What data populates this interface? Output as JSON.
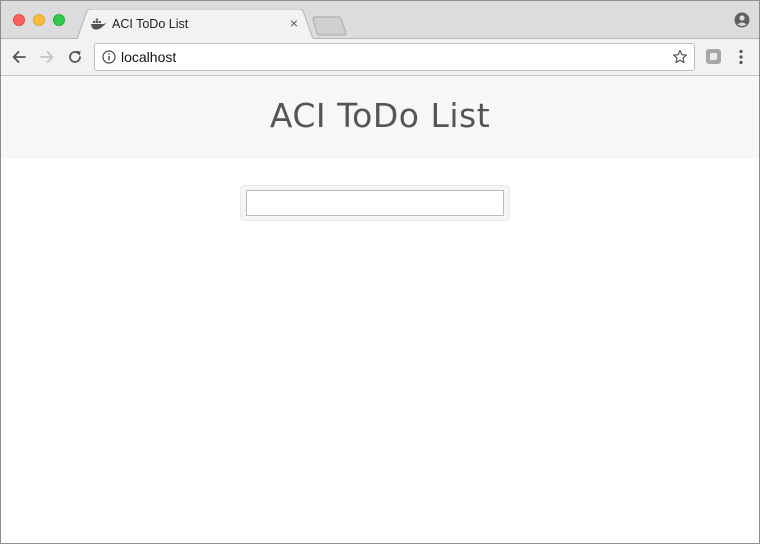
{
  "browser": {
    "tab": {
      "title": "ACI ToDo List",
      "close_glyph": "×",
      "favicon": "docker-whale-icon"
    },
    "address_bar": {
      "url": "localhost"
    },
    "icons": {
      "back": "arrow-left-icon",
      "forward": "arrow-right-icon",
      "reload": "reload-icon",
      "info": "info-icon",
      "bookmark": "star-icon",
      "extension": "extension-icon",
      "menu": "kebab-menu-icon",
      "profile": "profile-icon"
    },
    "colors": {
      "close": "#fc605c",
      "minimize": "#fdbc40",
      "zoom": "#34c84a"
    }
  },
  "page": {
    "title": "ACI ToDo List",
    "todo_input": {
      "value": "",
      "placeholder": ""
    }
  }
}
